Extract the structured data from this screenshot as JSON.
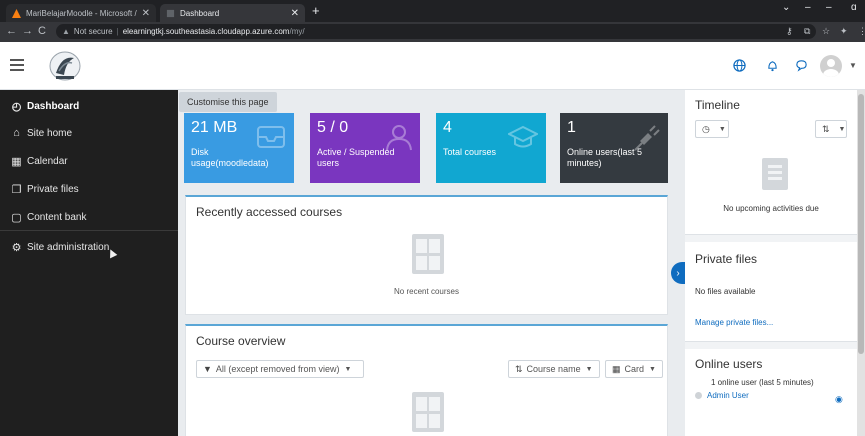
{
  "browser": {
    "tabs": [
      {
        "label": "MariBelajarMoodle - Microsoft /"
      },
      {
        "label": "Dashboard"
      }
    ],
    "url": {
      "warning": "Not secure",
      "host": "elearningtkj.southeastasia.cloudapp.azure.com",
      "path": "/my/"
    }
  },
  "drawer": {
    "items": [
      {
        "label": "Dashboard",
        "icon": "dashboard-icon"
      },
      {
        "label": "Site home",
        "icon": "home-icon"
      },
      {
        "label": "Calendar",
        "icon": "calendar-icon"
      },
      {
        "label": "Private files",
        "icon": "files-icon"
      },
      {
        "label": "Content bank",
        "icon": "content-bank-icon"
      },
      {
        "label": "Site administration",
        "icon": "gear-icon"
      }
    ]
  },
  "main": {
    "customise_label": "Customise this page",
    "stats": [
      {
        "value": "21 MB",
        "label": "Disk usage(moodledata)",
        "color": "#399be2"
      },
      {
        "value": "5 / 0",
        "label": "Active / Suspended users",
        "color": "#7a36bf"
      },
      {
        "value": "4",
        "label": "Total courses",
        "color": "#11a7d1"
      },
      {
        "value": "1",
        "label": "Online users(last 5 minutes)",
        "color": "#343a40"
      }
    ],
    "recent": {
      "title": "Recently accessed courses",
      "empty": "No recent courses"
    },
    "overview": {
      "title": "Course overview",
      "filter": "All (except removed from view)",
      "sort": "Course name",
      "view": "Card"
    }
  },
  "right": {
    "timeline": {
      "title": "Timeline",
      "empty": "No upcoming activities due"
    },
    "private_files": {
      "title": "Private files",
      "empty": "No files available",
      "manage_link": "Manage private files..."
    },
    "online_users": {
      "title": "Online users",
      "summary": "1 online user (last 5 minutes)",
      "users": [
        "Admin User"
      ]
    }
  },
  "colors": {
    "brand": "#0f6cbf",
    "drawer_bg": "#1f1f1f"
  }
}
